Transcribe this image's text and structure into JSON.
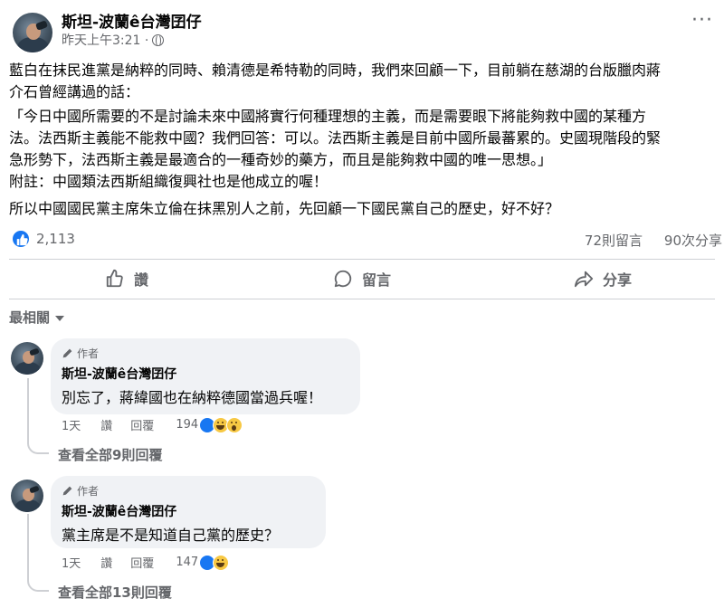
{
  "post": {
    "author": "斯坦-波蘭ê台灣囝仔",
    "time": "昨天上午3:21 ·",
    "more_icon": "more-horizontal-icon",
    "paragraph1": "藍白在抹民進黨是納粹的同時、賴清德是希特勒的同時，我們來回顧一下，目前躺在慈湖的台版臘肉蔣\n介石曾經講過的話：",
    "paragraph2": "「今日中國所需要的不是討論未來中國將實行何種理想的主義，而是需要眼下將能夠救中國的某種方\n法。法西斯主義能不能救中國？我們回答：可以。法西斯主義是目前中國所最蕃累的。史國現階段的緊\n急形勢下，法西斯主義是最適合的一種奇妙的藥方，而且是能夠救中國的唯一思想。」\n附註：中國類法西斯組織復興社也是他成立的喔！",
    "paragraph3": "所以中國國民黨主席朱立倫在抹黑別人之前，先回顧一下國民黨自己的歷史，好不好？",
    "reactions_count": "2,113",
    "comments_count": "72則留言",
    "shares_count": "90次分享"
  },
  "actions": {
    "like": "讚",
    "comment": "留言",
    "share": "分享"
  },
  "sort": {
    "label": "最相關"
  },
  "comments": [
    {
      "badge": "作者",
      "name": "斯坦-波蘭ê台灣囝仔",
      "text": "別忘了，蔣緯國也在納粹德國當過兵喔！",
      "age": "1天",
      "like": "讚",
      "reply": "回覆",
      "reaction_count": "194",
      "view_replies": "查看全部9則回覆"
    },
    {
      "badge": "作者",
      "name": "斯坦-波蘭ê台灣囝仔",
      "text": "黨主席是不是知道自己黨的歷史？",
      "age": "1天",
      "like": "讚",
      "reply": "回覆",
      "reaction_count": "147",
      "view_replies": "查看全部13則回覆"
    }
  ],
  "colors": {
    "facebook_blue": "#1877f2",
    "secondary_text": "#65676b",
    "bubble_bg": "#f0f2f5"
  }
}
